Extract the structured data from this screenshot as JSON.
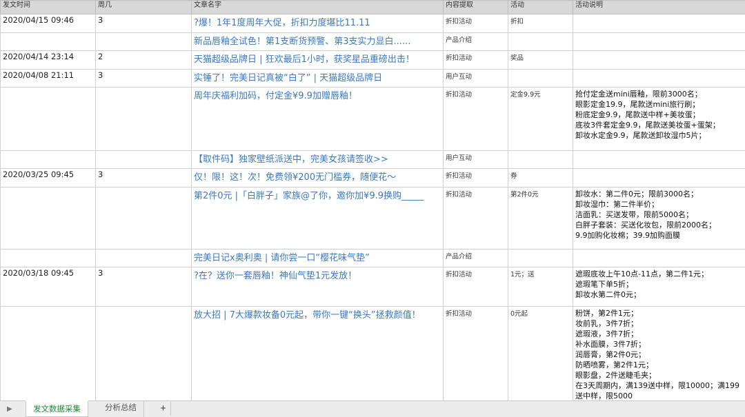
{
  "headers": [
    "发文时间",
    "周几",
    "文章名字",
    "内容提取",
    "活动",
    "活动说明"
  ],
  "rows": [
    {
      "date": "2020/04/15 09:46",
      "weekday": "3",
      "title": "?爆！1年1度周年大促，折扣力度堪比11.11",
      "type": "折扣活动",
      "activity": "折扣",
      "desc": []
    },
    {
      "date": "",
      "weekday": "",
      "title": "新品唇釉全试色！第1支断货预警、第3支实力显白......",
      "type": "产品介绍",
      "activity": "",
      "desc": []
    },
    {
      "date": "2020/04/14 23:14",
      "weekday": "2",
      "title": "天猫超级品牌日 | 狂欢最后1小时，获奖星品重磅出击！",
      "type": "折扣活动",
      "activity": "奖品",
      "desc": []
    },
    {
      "date": "2020/04/08 21:11",
      "weekday": "3",
      "title": "实锤了！完美日记真被“白了” | 天猫超级品牌日",
      "type": "用户互动",
      "activity": "",
      "desc": []
    },
    {
      "date": "",
      "weekday": "",
      "title": "周年庆福利加码，付定金¥9.9加赠唇釉！",
      "type": "折扣活动",
      "activity": "定金9.9元",
      "desc": [
        "抢付定金送mini唇釉，限前3000名；",
        "眼影定金19.9，尾款送mini旅行刷；",
        "粉底定金9.9，尾款送中样+美妆蛋；",
        "底妆3件套定金9.9，尾款送美妆蛋+蛋架；",
        "卸妆水定金9.9，尾款送卸妆湿巾5片；"
      ]
    },
    {
      "date": "",
      "weekday": "",
      "title": "【取件码】独家壁纸派送中，完美女孩请签收>>",
      "type": "用户互动",
      "activity": "",
      "desc": []
    },
    {
      "date": "2020/03/25 09:45",
      "weekday": "3",
      "title": "仅！限！这！次！免费领¥200无门槛券，随便花～",
      "type": "折扣活动",
      "activity": "券",
      "desc": []
    },
    {
      "date": "",
      "weekday": "",
      "title": "第2件0元 |「白胖子」家族@了你，邀你加¥9.9换购_____",
      "type": "折扣活动",
      "activity": "第2件0元",
      "desc": [
        "卸妆水：第二件0元；限前3000名；",
        "卸妆湿巾：第二件半价；",
        "洁面乳：买送发带，限前5000名；",
        "白胖子套装：买送化妆包，限前2000名；",
        "9.9加购化妆棉；39.9加购面膜"
      ]
    },
    {
      "date": "",
      "weekday": "",
      "title": "完美日记x奥利奥 | 请你尝一口“樱花味气垫”",
      "type": "产品介绍",
      "activity": "",
      "desc": []
    },
    {
      "date": "2020/03/18 09:45",
      "weekday": "3",
      "title": "?在？送你一套唇釉！神仙气垫1元发放！",
      "type": "折扣活动",
      "activity": "1元；送",
      "desc": [
        "遮瑕底妆上午10点-11点，第二件1元；",
        "遮瑕笔下单5折；",
        "卸妆水第二件0元；"
      ]
    },
    {
      "date": "",
      "weekday": "",
      "title": "放大招 | 7大爆款妆备0元起，带你一键“换头”拯救颜值！",
      "type": "折扣活动",
      "activity": "0元起",
      "desc": [
        "粉饼，第2件1元；",
        "妆前乳，3件7折；",
        "遮瑕液，3件7折；",
        "补水面膜，3件7折；",
        "润唇膏，第2件0元；",
        "防晒喷雾，第2件1元；",
        "眼影盘，2件送睫毛夹；",
        "在3天周期内，满139送中样，限10000；满199",
        "送中样，限5000"
      ]
    }
  ],
  "row_heights": [
    27,
    26,
    27,
    26,
    92,
    26,
    27,
    90,
    26,
    57,
    140
  ],
  "tabs": [
    "发文数据采集",
    "分析总结"
  ],
  "tab_add": "+",
  "tab_nav": "▶",
  "colors": {
    "link": "#3a78c4",
    "header_bg": "#d8d8d8",
    "active_tab": "#1e8a3c"
  }
}
